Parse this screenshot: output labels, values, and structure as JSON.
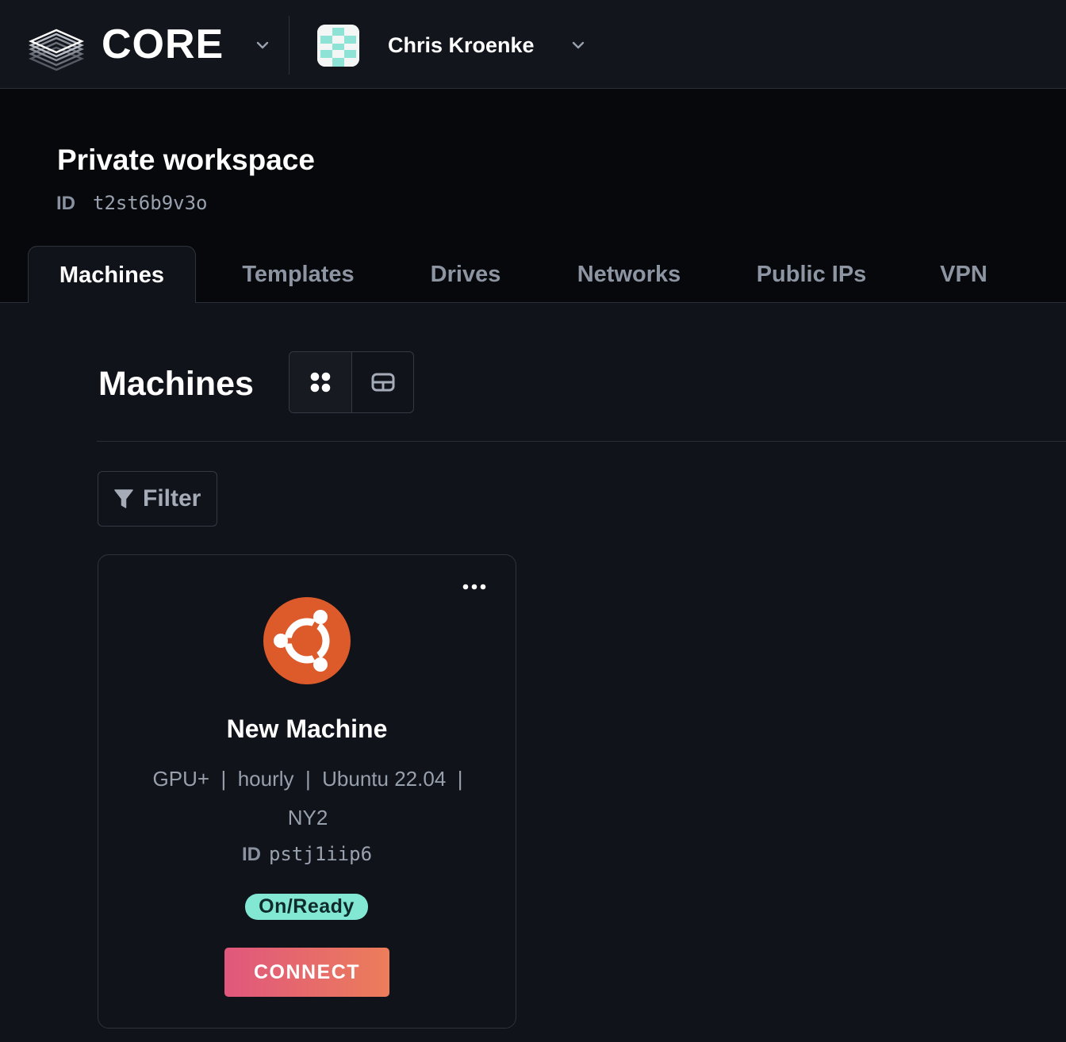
{
  "topbar": {
    "brand": "CORE",
    "user_name": "Chris Kroenke",
    "icons": [
      "layers-logo-icon",
      "chevron-down-icon",
      "user-avatar",
      "chevron-down-icon"
    ]
  },
  "workspace": {
    "title": "Private workspace",
    "id_label": "ID",
    "id_value": "t2st6b9v3o"
  },
  "tabs": [
    {
      "label": "Machines",
      "active": true
    },
    {
      "label": "Templates",
      "active": false
    },
    {
      "label": "Drives",
      "active": false
    },
    {
      "label": "Networks",
      "active": false
    },
    {
      "label": "Public IPs",
      "active": false
    },
    {
      "label": "VPN",
      "active": false
    }
  ],
  "section": {
    "title": "Machines",
    "view_modes": [
      "grid-view-icon",
      "table-view-icon"
    ],
    "filter_label": "Filter"
  },
  "machine": {
    "name": "New Machine",
    "meta_line1": "GPU+  |  hourly  |  Ubuntu 22.04  |",
    "meta_line2": "NY2",
    "id_label": "ID",
    "id_value": "pstj1iip6",
    "status": "On/Ready",
    "connect_label": "CONNECT",
    "os_icon": "ubuntu-icon"
  },
  "colors": {
    "background": "#10131a",
    "header_bg": "#07080c",
    "status_bg": "#82e8d3",
    "connect_gradient_start": "#e0577d",
    "connect_gradient_end": "#ec7d5a",
    "ubuntu_orange": "#dd5a2b"
  }
}
